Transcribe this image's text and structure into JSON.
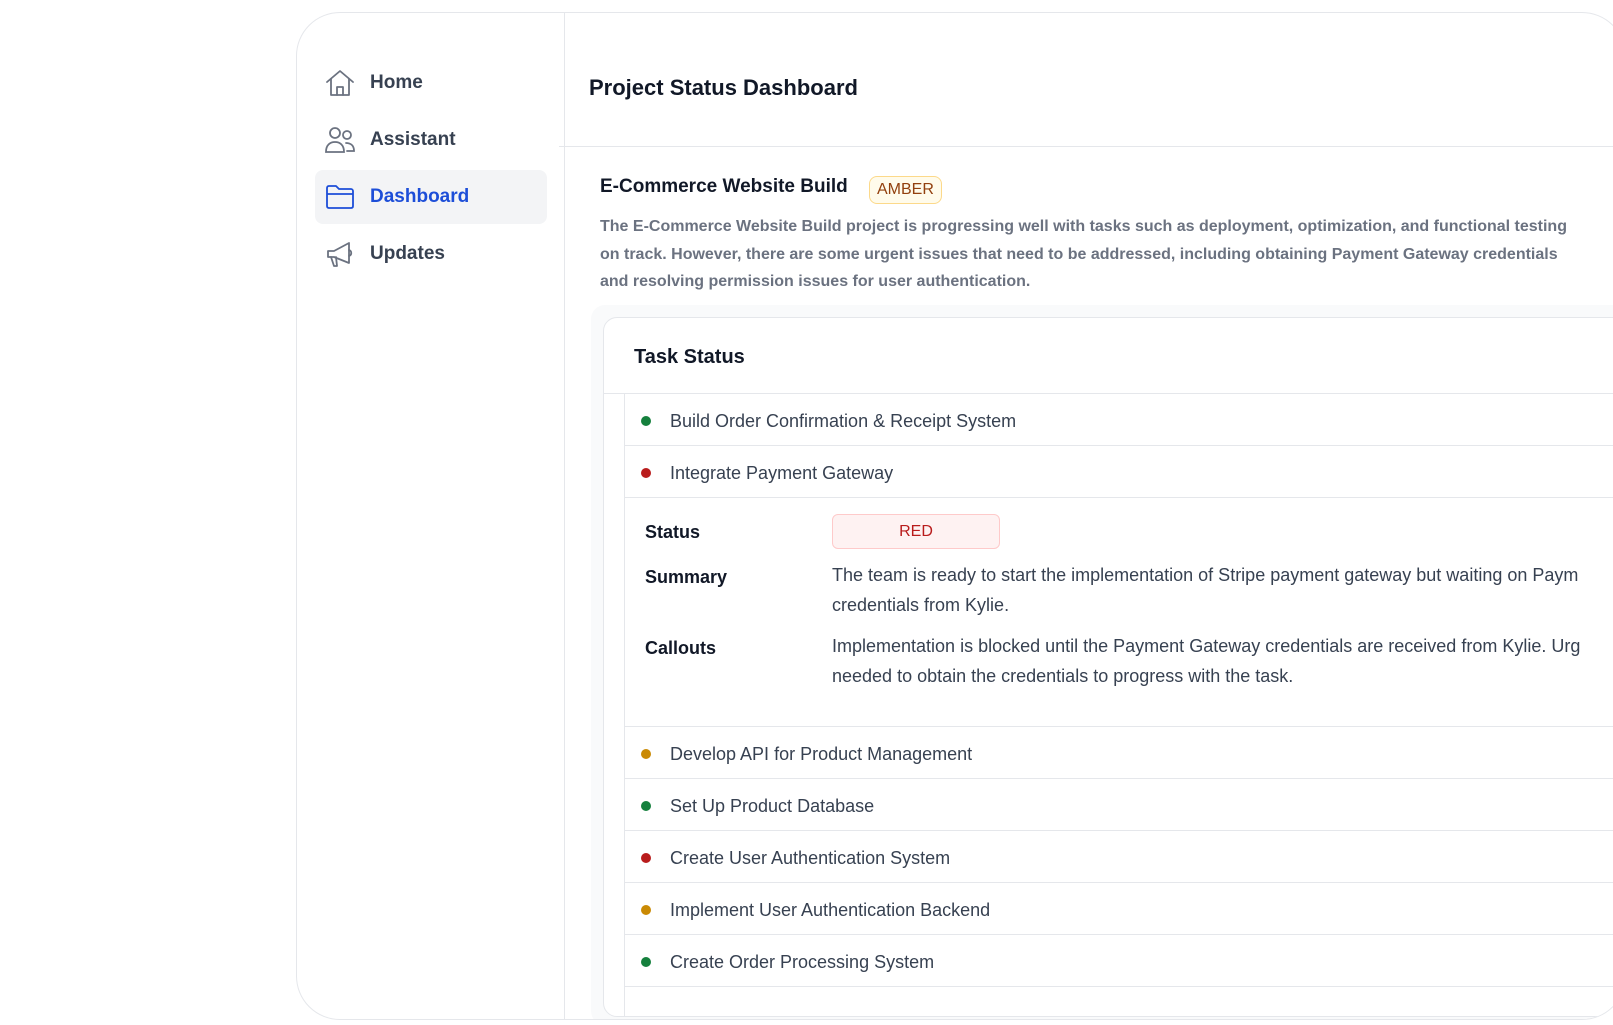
{
  "sidebar": {
    "items": [
      {
        "label": "Home",
        "icon": "home-icon"
      },
      {
        "label": "Assistant",
        "icon": "users-icon"
      },
      {
        "label": "Dashboard",
        "icon": "folder-icon",
        "active": true
      },
      {
        "label": "Updates",
        "icon": "megaphone-icon"
      }
    ]
  },
  "header": {
    "title": "Project Status Dashboard"
  },
  "project": {
    "title": "E-Commerce Website Build",
    "status": "AMBER",
    "description": "The E-Commerce Website Build project is progressing well with tasks such as deployment, optimization, and functional testing on track. However, there are some urgent issues that need to be addressed, including obtaining Payment Gateway credentials and resolving permission issues for user authentication."
  },
  "task_status": {
    "title": "Task Status",
    "tasks": [
      {
        "label": "Build Order Confirmation & Receipt System",
        "status": "green"
      },
      {
        "label": "Integrate Payment Gateway",
        "status": "red"
      },
      {
        "label": "Develop API for Product Management",
        "status": "amber"
      },
      {
        "label": "Set Up Product Database",
        "status": "green"
      },
      {
        "label": "Create User Authentication System",
        "status": "red"
      },
      {
        "label": "Implement User Authentication Backend",
        "status": "amber"
      },
      {
        "label": "Create Order Processing System",
        "status": "green"
      }
    ],
    "detail": {
      "status_label": "Status",
      "status_value": "RED",
      "summary_label": "Summary",
      "summary_line1": "The team is ready to start the implementation of Stripe payment gateway but waiting on Paym",
      "summary_line2": "credentials from Kylie.",
      "callouts_label": "Callouts",
      "callouts_line1": "Implementation is blocked until the Payment Gateway credentials are received from Kylie. Urg",
      "callouts_line2": "needed to obtain the credentials to progress with the task."
    }
  },
  "colors": {
    "green": "#15803d",
    "red": "#b91c1c",
    "amber": "#ca8a04",
    "accent": "#1d4ed8"
  }
}
